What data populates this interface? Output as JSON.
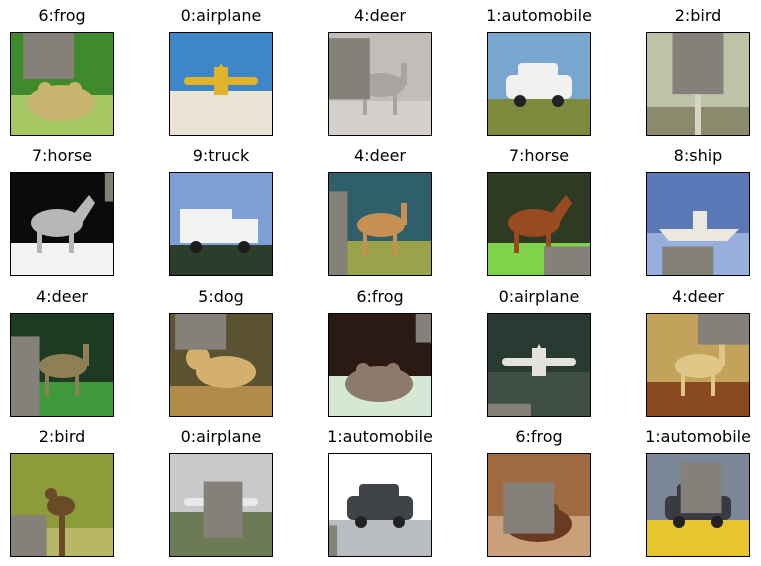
{
  "figure": {
    "patch_color": "#858079",
    "images": [
      {
        "label": "6:frog",
        "subject": "frog",
        "colors": [
          "#3f8a2c",
          "#a7c965",
          "#c7b46e"
        ],
        "patch": [
          0.12,
          0.0,
          0.5,
          0.45
        ]
      },
      {
        "label": "0:airplane",
        "subject": "airplane",
        "colors": [
          "#3f86c8",
          "#e9e3d4",
          "#e0b42a"
        ],
        "patch": null
      },
      {
        "label": "4:deer",
        "subject": "deer",
        "colors": [
          "#c2bdb9",
          "#d3cfcb",
          "#a9a4a0"
        ],
        "patch": [
          0.0,
          0.05,
          0.4,
          0.6
        ]
      },
      {
        "label": "1:automobile",
        "subject": "automobile",
        "colors": [
          "#79a6cf",
          "#7b8a3c",
          "#f1f1f0"
        ],
        "patch": null
      },
      {
        "label": "2:bird",
        "subject": "bird",
        "colors": [
          "#bdc3a6",
          "#8c8a6d",
          "#d5d6c6"
        ],
        "patch": [
          0.25,
          0.0,
          0.5,
          0.6
        ]
      },
      {
        "label": "7:horse",
        "subject": "horse",
        "colors": [
          "#0b0b0b",
          "#f3f3f3",
          "#b7b7b7"
        ],
        "patch": [
          0.92,
          0.0,
          0.1,
          0.28
        ]
      },
      {
        "label": "9:truck",
        "subject": "truck",
        "colors": [
          "#7d9fd4",
          "#2b3d2b",
          "#f2f2f2"
        ],
        "patch": null
      },
      {
        "label": "4:deer",
        "subject": "deer",
        "colors": [
          "#2f5f6a",
          "#9aa34a",
          "#c59052"
        ],
        "patch": [
          0.0,
          0.18,
          0.18,
          0.82
        ]
      },
      {
        "label": "7:horse",
        "subject": "horse",
        "colors": [
          "#2f3a23",
          "#7fd34a",
          "#9a4a21"
        ],
        "patch": [
          0.55,
          0.72,
          0.45,
          0.28
        ]
      },
      {
        "label": "8:ship",
        "subject": "ship",
        "colors": [
          "#5a78b6",
          "#98aedd",
          "#ece7df"
        ],
        "patch": [
          0.15,
          0.72,
          0.5,
          0.28
        ]
      },
      {
        "label": "4:deer",
        "subject": "deer",
        "colors": [
          "#1c3b22",
          "#3f9a3d",
          "#8f7f55"
        ],
        "patch": [
          0.0,
          0.22,
          0.28,
          0.78
        ]
      },
      {
        "label": "5:dog",
        "subject": "dog",
        "colors": [
          "#5b5231",
          "#b18b49",
          "#d4b06c"
        ],
        "patch": [
          0.05,
          0.0,
          0.5,
          0.35
        ]
      },
      {
        "label": "6:frog",
        "subject": "frog",
        "colors": [
          "#2a1a13",
          "#d5e8d3",
          "#8b7a6c"
        ],
        "patch": [
          0.85,
          0.0,
          0.15,
          0.28
        ]
      },
      {
        "label": "0:airplane",
        "subject": "airplane",
        "colors": [
          "#293a32",
          "#3f4f46",
          "#e3e3dc"
        ],
        "patch": [
          0.0,
          0.88,
          0.42,
          0.12
        ]
      },
      {
        "label": "4:deer",
        "subject": "deer",
        "colors": [
          "#c3a25c",
          "#8a4a20",
          "#e0c788"
        ],
        "patch": [
          0.5,
          0.0,
          0.5,
          0.3
        ]
      },
      {
        "label": "2:bird",
        "subject": "bird",
        "colors": [
          "#8c9c3a",
          "#b7b766",
          "#6b4a2a"
        ],
        "patch": [
          0.0,
          0.6,
          0.35,
          0.4
        ]
      },
      {
        "label": "0:airplane",
        "subject": "airplane",
        "colors": [
          "#c7c9cb",
          "#6c7b55",
          "#e9e9e9"
        ],
        "patch": [
          0.33,
          0.27,
          0.38,
          0.55
        ]
      },
      {
        "label": "1:automobile",
        "subject": "automobile",
        "colors": [
          "#ffffff",
          "#b9bcc1",
          "#3f4246"
        ],
        "patch": [
          0.0,
          0.7,
          0.08,
          0.3
        ]
      },
      {
        "label": "6:frog",
        "subject": "frog",
        "colors": [
          "#9f6a3f",
          "#c9a07a",
          "#6b3a22"
        ],
        "patch": [
          0.15,
          0.28,
          0.5,
          0.5
        ]
      },
      {
        "label": "1:automobile",
        "subject": "automobile",
        "colors": [
          "#7b8796",
          "#e7c52c",
          "#393b40"
        ],
        "patch": [
          0.33,
          0.08,
          0.4,
          0.5
        ]
      }
    ]
  }
}
